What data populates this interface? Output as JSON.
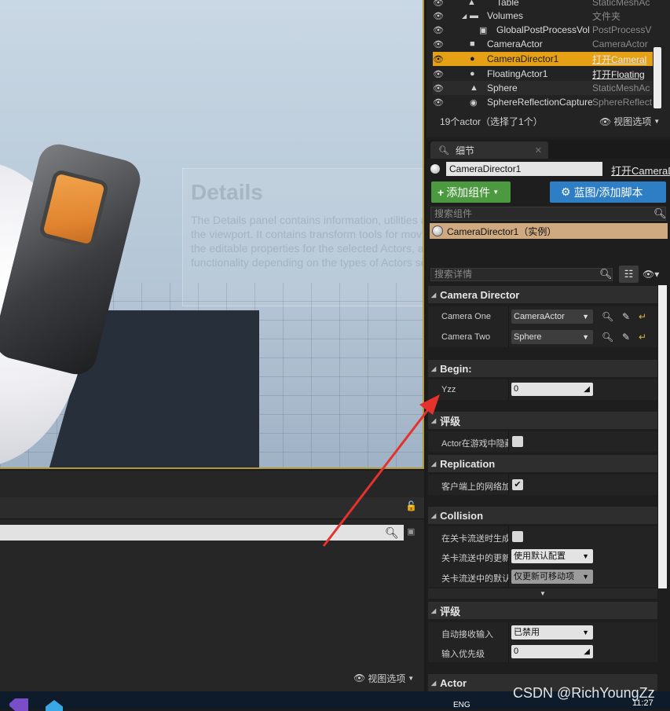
{
  "viewport": {
    "overlay_title": "Details",
    "overlay_text": "The Details panel contains information, utilities and functions specific to the current selection in the viewport. It contains transform tools for moving, rotating, and scaling Actors, displays all of the editable properties for the selected Actors, and provides quick access to additional editing functionality depending on the types of Actors selected in the viewport."
  },
  "bottom_left": {
    "view_options": "视图选项"
  },
  "outliner": {
    "rows": [
      {
        "label": "Table",
        "type": "StaticMeshAc",
        "icon": "mesh-icon"
      },
      {
        "label": "Volumes",
        "type": "文件夹",
        "icon": "folder-icon"
      },
      {
        "label": "GlobalPostProcessVol",
        "type": "PostProcessV",
        "icon": "postprocess-icon"
      },
      {
        "label": "CameraActor",
        "type": "CameraActor",
        "icon": "camera-icon"
      },
      {
        "label": "CameraDirector1",
        "type": "打开Cameral",
        "icon": "sphere-icon",
        "selected": true
      },
      {
        "label": "FloatingActor1",
        "type": "打开Floating",
        "icon": "sphere-icon"
      },
      {
        "label": "Sphere",
        "type": "StaticMeshAc",
        "icon": "mesh-icon"
      },
      {
        "label": "SphereReflectionCapture",
        "type": "SphereReflect",
        "icon": "reflection-icon"
      }
    ],
    "count_text": "19个actor（选择了1个）",
    "view_options": "视图选项"
  },
  "details": {
    "tab_label": "细节",
    "actor_name": "CameraDirector1",
    "actor_link": "打开CameraD",
    "add_component": "添加组件",
    "blueprint": "蓝图/添加脚本",
    "component_search_placeholder": "搜索组件",
    "component_item": "CameraDirector1（实例）",
    "detail_search_placeholder": "搜索详情",
    "categories": {
      "camera_director": "Camera Director",
      "begin": "Begin:",
      "rendering": "评级",
      "replication": "Replication",
      "collision": "Collision",
      "input": "评级",
      "actor": "Actor"
    },
    "props": {
      "camera_one": {
        "name": "Camera One",
        "value": "CameraActor"
      },
      "camera_two": {
        "name": "Camera Two",
        "value": "Sphere"
      },
      "yzz": {
        "name": "Yzz",
        "value": "0"
      },
      "hidden_in_game": {
        "name": "Actor在游戏中隐藏",
        "checked": false
      },
      "net_load": {
        "name": "客户端上的网络加载",
        "checked": true
      },
      "gen_overlap": {
        "name": "在关卡流送时生成重叠事件",
        "checked": false
      },
      "update_overlap": {
        "name": "关卡流送中的更新重叠方法",
        "value": "使用默认配置"
      },
      "default_overlap": {
        "name": "关卡流送中的默认更新重叠方法",
        "value": "仅更新可移动项"
      },
      "auto_input": {
        "name": "自动接收输入",
        "value": "已禁用"
      },
      "input_priority": {
        "name": "输入优先级",
        "value": "0"
      }
    }
  },
  "taskbar": {
    "lang": "ENG",
    "time": "11:27"
  },
  "watermark": "CSDN @RichYoungZz",
  "colors": {
    "selection": "#e6a016",
    "add_component_green": "#4c9a3f",
    "blueprint_blue": "#2e7ec6",
    "arrow_red": "#e5322d"
  }
}
